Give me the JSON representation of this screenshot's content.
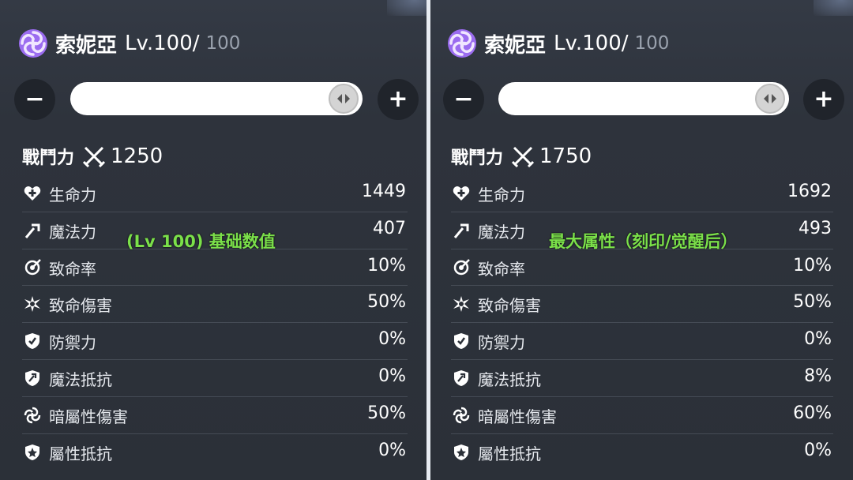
{
  "colors": {
    "accent_purple": "#b58cff",
    "overlay_green": "#7be04a",
    "divider": "#e8ecf2"
  },
  "panels": [
    {
      "name": "索妮亞",
      "level": "Lv.100/",
      "max_level": "100",
      "level_fraction": 1.0,
      "minus": "−",
      "plus": "+",
      "power_label": "戰鬥力",
      "power_value": "1250",
      "overlay": "(Lv 100) 基础数值",
      "stats": [
        {
          "icon": "heart-plus-icon",
          "label": "生命力",
          "value": "1449"
        },
        {
          "icon": "magic-wand-icon",
          "label": "魔法力",
          "value": "407"
        },
        {
          "icon": "crit-target-icon",
          "label": "致命率",
          "value": "10%"
        },
        {
          "icon": "burst-icon",
          "label": "致命傷害",
          "value": "50%"
        },
        {
          "icon": "shield-icon",
          "label": "防禦力",
          "value": "0%"
        },
        {
          "icon": "magic-shield-icon",
          "label": "魔法抵抗",
          "value": "0%"
        },
        {
          "icon": "dark-swirl-icon",
          "label": "暗屬性傷害",
          "value": "50%"
        },
        {
          "icon": "element-shield-icon",
          "label": "屬性抵抗",
          "value": "0%"
        }
      ]
    },
    {
      "name": "索妮亞",
      "level": "Lv.100/",
      "max_level": "100",
      "level_fraction": 1.0,
      "minus": "−",
      "plus": "+",
      "power_label": "戰鬥力",
      "power_value": "1750",
      "overlay": "最大属性（刻印/觉醒后）",
      "stats": [
        {
          "icon": "heart-plus-icon",
          "label": "生命力",
          "value": "1692"
        },
        {
          "icon": "magic-wand-icon",
          "label": "魔法力",
          "value": "493"
        },
        {
          "icon": "crit-target-icon",
          "label": "致命率",
          "value": "10%"
        },
        {
          "icon": "burst-icon",
          "label": "致命傷害",
          "value": "50%"
        },
        {
          "icon": "shield-icon",
          "label": "防禦力",
          "value": "0%"
        },
        {
          "icon": "magic-shield-icon",
          "label": "魔法抵抗",
          "value": "8%"
        },
        {
          "icon": "dark-swirl-icon",
          "label": "暗屬性傷害",
          "value": "60%"
        },
        {
          "icon": "element-shield-icon",
          "label": "屬性抵抗",
          "value": "0%"
        }
      ]
    }
  ]
}
